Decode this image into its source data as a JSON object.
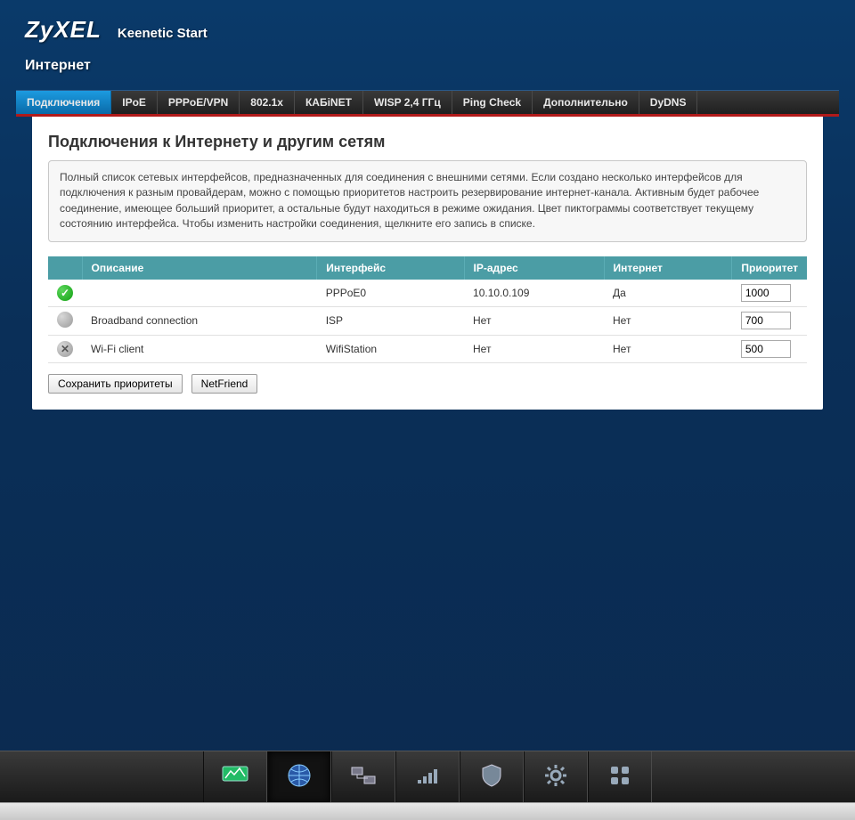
{
  "brand": "ZyXEL",
  "model": "Keenetic Start",
  "section": "Интернет",
  "tabs": [
    {
      "label": "Подключения",
      "active": true
    },
    {
      "label": "IPoE",
      "active": false
    },
    {
      "label": "PPPoE/VPN",
      "active": false
    },
    {
      "label": "802.1x",
      "active": false
    },
    {
      "label": "КАБiNET",
      "active": false
    },
    {
      "label": "WISP 2,4 ГГц",
      "active": false
    },
    {
      "label": "Ping Check",
      "active": false
    },
    {
      "label": "Дополнительно",
      "active": false
    },
    {
      "label": "DyDNS",
      "active": false
    }
  ],
  "panel": {
    "title": "Подключения к Интернету и другим сетям",
    "info_text": "Полный список сетевых интерфейсов, предназначенных для соединения с внешними сетями. Если создано несколько интерфейсов для подключения к разным провайдерам, можно с помощью приоритетов настроить резервирование интернет-канала. Активным будет рабочее соединение, имеющее больший приоритет, а остальные будут находиться в режиме ожидания. Цвет пиктограммы соответствует текущему состоянию интерфейса. Чтобы изменить настройки соединения, щелкните его запись в списке.",
    "columns": {
      "description": "Описание",
      "interface": "Интерфейс",
      "ip": "IP-адрес",
      "internet": "Интернет",
      "priority": "Приоритет"
    },
    "rows": [
      {
        "status": "ok",
        "description": "",
        "interface": "PPPoE0",
        "ip": "10.10.0.109",
        "internet": "Да",
        "priority": "1000"
      },
      {
        "status": "neutral",
        "description": "Broadband connection",
        "interface": "ISP",
        "ip": "Нет",
        "internet": "Нет",
        "priority": "700"
      },
      {
        "status": "off",
        "description": "Wi-Fi client",
        "interface": "WifiStation",
        "ip": "Нет",
        "internet": "Нет",
        "priority": "500"
      }
    ],
    "buttons": {
      "save": "Сохранить приоритеты",
      "netfriend": "NetFriend"
    }
  },
  "dock": [
    {
      "name": "monitor",
      "active": false
    },
    {
      "name": "globe",
      "active": true
    },
    {
      "name": "network",
      "active": false
    },
    {
      "name": "wifi",
      "active": false
    },
    {
      "name": "firewall",
      "active": false
    },
    {
      "name": "settings",
      "active": false
    },
    {
      "name": "apps",
      "active": false
    }
  ]
}
